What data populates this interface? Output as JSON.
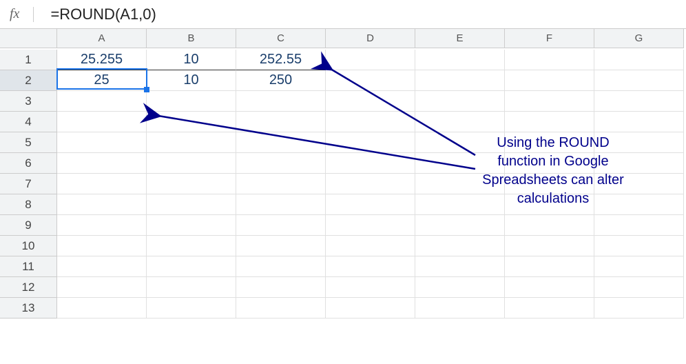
{
  "formula_bar": {
    "fx_label": "fx",
    "formula": "=ROUND(A1,0)"
  },
  "columns": [
    "A",
    "B",
    "C",
    "D",
    "E",
    "F",
    "G"
  ],
  "rows": [
    "1",
    "2",
    "3",
    "4",
    "5",
    "6",
    "7",
    "8",
    "9",
    "10",
    "11",
    "12",
    "13"
  ],
  "grid": {
    "r1": {
      "A": "25.255",
      "B": "10",
      "C": "252.55"
    },
    "r2": {
      "A": "25",
      "B": "10",
      "C": "250"
    }
  },
  "selection": {
    "cell": "A2"
  },
  "annotation": {
    "text": "Using the ROUND function in Google Spreadsheets can alter calculations"
  }
}
